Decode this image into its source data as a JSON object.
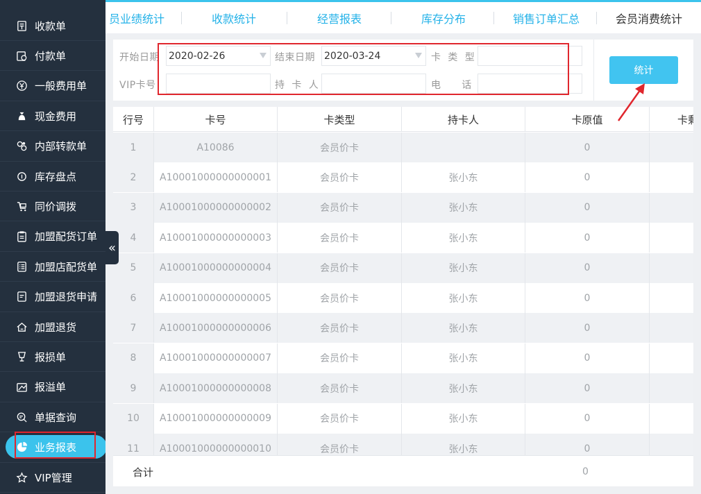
{
  "sidebar": {
    "items": [
      {
        "label": "收款单",
        "icon": "receipt-icon"
      },
      {
        "label": "付款单",
        "icon": "payment-icon"
      },
      {
        "label": "一般费用单",
        "icon": "yen-circle-icon"
      },
      {
        "label": "现金费用",
        "icon": "money-bag-icon"
      },
      {
        "label": "内部转款单",
        "icon": "transfer-icon"
      },
      {
        "label": "库存盘点",
        "icon": "inventory-icon"
      },
      {
        "label": "同价调拨",
        "icon": "cart-transfer-icon"
      },
      {
        "label": "加盟配货订单",
        "icon": "clipboard-icon"
      },
      {
        "label": "加盟店配货单",
        "icon": "list-doc-icon"
      },
      {
        "label": "加盟退货申请",
        "icon": "return-doc-icon"
      },
      {
        "label": "加盟退货",
        "icon": "home-return-icon"
      },
      {
        "label": "报损单",
        "icon": "broken-glass-icon"
      },
      {
        "label": "报溢单",
        "icon": "overflow-icon"
      },
      {
        "label": "单据查询",
        "icon": "search-doc-icon"
      },
      {
        "label": "业务报表",
        "icon": "pie-chart-icon",
        "active": true
      },
      {
        "label": "VIP管理",
        "icon": "star-badge-icon"
      }
    ],
    "collapse_glyph": "«"
  },
  "tabs": [
    {
      "label": "员业绩统计"
    },
    {
      "label": "收款统计"
    },
    {
      "label": "经营报表"
    },
    {
      "label": "库存分布"
    },
    {
      "label": "销售订单汇总"
    },
    {
      "label": "会员消费统计",
      "current": true
    }
  ],
  "filter": {
    "start_date_label": "开始日期",
    "start_date_value": "2020-02-26",
    "end_date_label": "结束日期",
    "end_date_value": "2020-03-24",
    "card_type_label": "卡  类  型",
    "card_type_value": "",
    "vip_card_label": "VIP卡号",
    "vip_card_value": "",
    "holder_label": "持  卡  人",
    "holder_value": "",
    "phone_label": "电      话",
    "phone_value": "",
    "stat_button": "统计"
  },
  "table": {
    "columns": [
      "行号",
      "卡号",
      "卡类型",
      "持卡人",
      "卡原值",
      "卡剩"
    ],
    "rows": [
      [
        "1",
        "A10086",
        "会员价卡",
        "",
        "0"
      ],
      [
        "2",
        "A10001000000000001",
        "会员价卡",
        "张小东",
        "0"
      ],
      [
        "3",
        "A10001000000000002",
        "会员价卡",
        "张小东",
        "0"
      ],
      [
        "4",
        "A10001000000000003",
        "会员价卡",
        "张小东",
        "0"
      ],
      [
        "5",
        "A10001000000000004",
        "会员价卡",
        "张小东",
        "0"
      ],
      [
        "6",
        "A10001000000000005",
        "会员价卡",
        "张小东",
        "0"
      ],
      [
        "7",
        "A10001000000000006",
        "会员价卡",
        "张小东",
        "0"
      ],
      [
        "8",
        "A10001000000000007",
        "会员价卡",
        "张小东",
        "0"
      ],
      [
        "9",
        "A10001000000000008",
        "会员价卡",
        "张小东",
        "0"
      ],
      [
        "10",
        "A10001000000000009",
        "会员价卡",
        "张小东",
        "0"
      ],
      [
        "11",
        "A10001000000000010",
        "会员价卡",
        "张小东",
        "0"
      ]
    ],
    "footer_label": "合计",
    "footer_value": "0"
  },
  "colors": {
    "sidebar_bg": "#24303e",
    "accent": "#3bc3ec",
    "annotation_red": "#e0262d"
  }
}
